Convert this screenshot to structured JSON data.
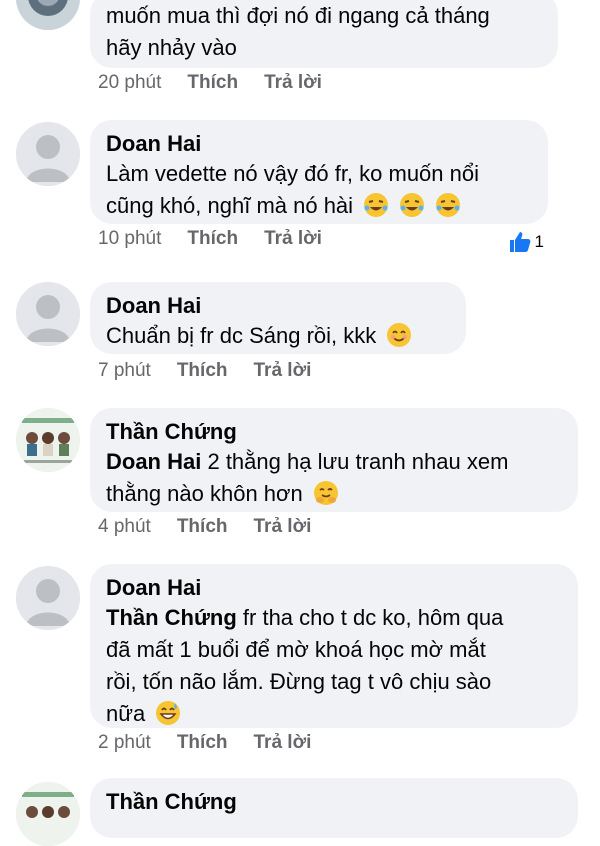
{
  "comments": [
    {
      "text_lines": [
        "muốn mua thì đợi nó đi ngang cả tháng",
        "hãy nhảy vào"
      ],
      "time": "20 phút",
      "like": "Thích",
      "reply": "Trả lời"
    },
    {
      "author": "Doan Hai",
      "text_lines": [
        "Làm vedette nó vậy đó fr, ko muốn nổi",
        "cũng khó, nghĩ mà nó hài"
      ],
      "time": "10 phút",
      "like": "Thích",
      "reply": "Trả lời",
      "reaction_count": "1"
    },
    {
      "author": "Doan Hai",
      "text_lines": [
        "Chuẩn bị fr dc Sáng rồi, kkk"
      ],
      "time": "7 phút",
      "like": "Thích",
      "reply": "Trả lời"
    },
    {
      "author": "Thần Chứng",
      "mention": "Doan Hai",
      "text_lines": [
        " 2 thằng hạ lưu tranh nhau xem",
        "thằng nào khôn hơn"
      ],
      "time": "4 phút",
      "like": "Thích",
      "reply": "Trả lời"
    },
    {
      "author": "Doan Hai",
      "mention": "Thần Chứng",
      "text_lines": [
        "  fr tha cho t dc ko, hôm qua",
        "đã mất 1 buổi để mờ khoá học mờ mắt",
        "rồi, tốn não lắm. Đừng tag t vô chịu sào",
        "nữa"
      ],
      "time": "2 phút",
      "like": "Thích",
      "reply": "Trả lời"
    },
    {
      "author": "Thần Chứng"
    }
  ],
  "icons": {
    "laugh": "rolling-laughing-emoji",
    "smile": "smiling-emoji",
    "hug": "hugging-emoji",
    "sweat": "grinning-sweat-emoji",
    "like": "thumbs-up-icon"
  },
  "colors": {
    "bubble": "#f0f2f5",
    "meta": "#65676b",
    "like_blue": "#1877f2"
  }
}
